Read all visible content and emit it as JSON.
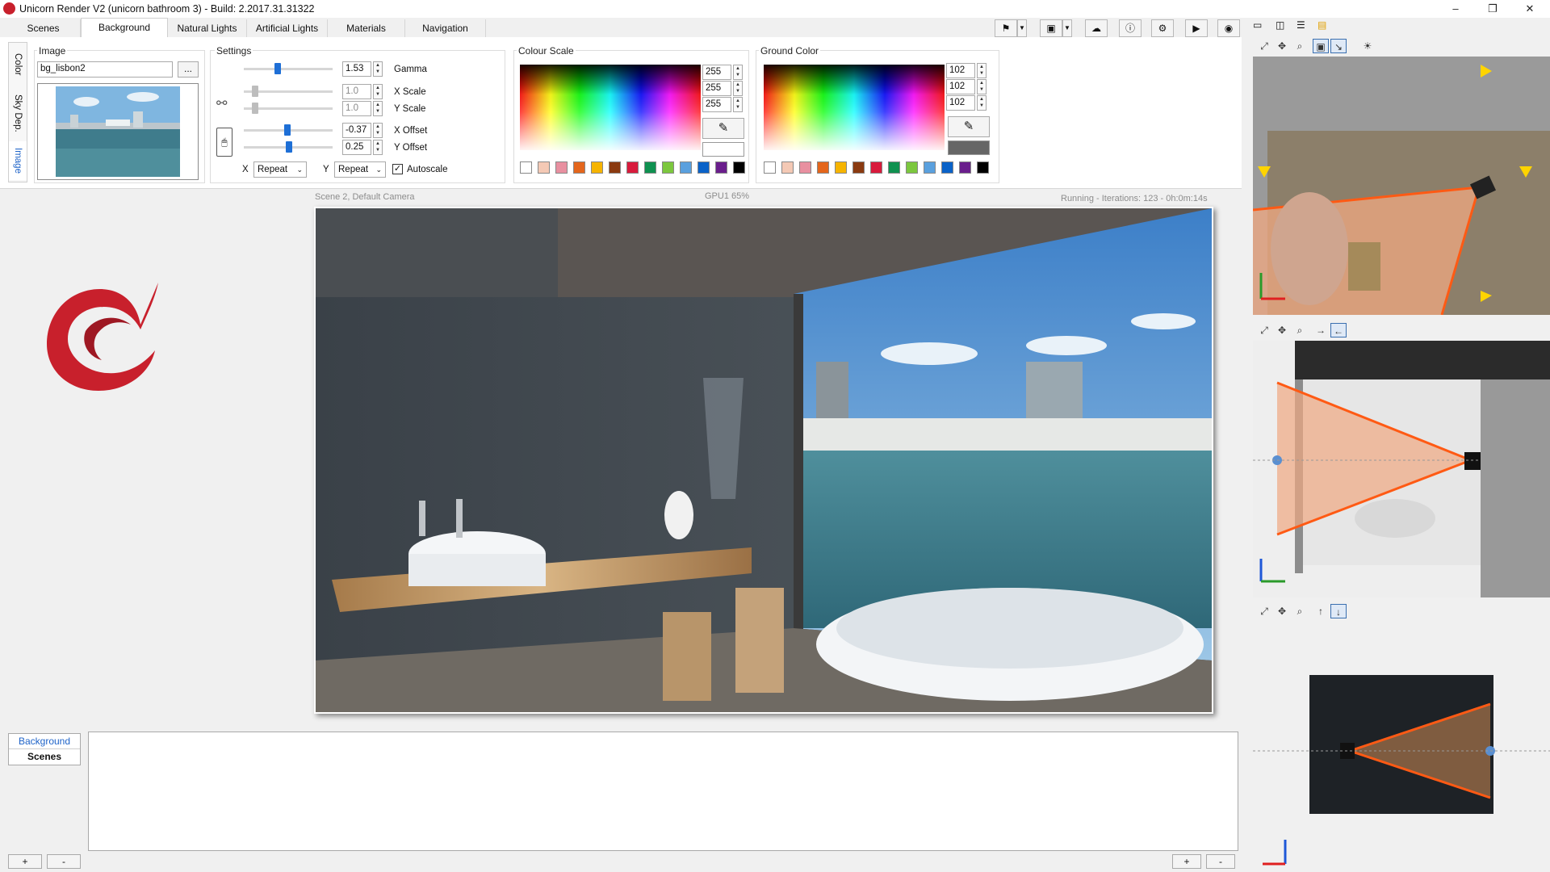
{
  "window": {
    "title": "Unicorn Render V2 (unicorn bathroom 3) - Build: 2.2017.31.31322",
    "minimize": "–",
    "restore": "❐",
    "close": "✕"
  },
  "tabs": [
    "Scenes",
    "Background",
    "Natural Lights",
    "Artificial Lights",
    "Materials",
    "Navigation"
  ],
  "active_tab": "Background",
  "toolbar": {
    "icons": [
      "flag-icon",
      "save-icon",
      "cloud-icon",
      "info-icon",
      "settings-icon",
      "render-icon",
      "camera-icon"
    ]
  },
  "side_tabs": [
    "Color",
    "Sky Dep.",
    "Image"
  ],
  "image_group": {
    "label": "Image",
    "filename": "bg_lisbon2",
    "browse": "..."
  },
  "settings": {
    "label": "Settings",
    "gamma": {
      "label": "Gamma",
      "value": "1.53",
      "level": 0.38
    },
    "x_scale": {
      "label": "X Scale",
      "value": "1.0",
      "level": 0.12
    },
    "y_scale": {
      "label": "Y Scale",
      "value": "1.0",
      "level": 0.12
    },
    "x_offset": {
      "label": "X Offset",
      "value": "-0.37",
      "level": 0.5
    },
    "y_offset": {
      "label": "Y Offset",
      "value": "0.25",
      "level": 0.52
    },
    "x_repeat_label": "X",
    "x_repeat": "Repeat",
    "y_repeat_label": "Y",
    "y_repeat": "Repeat",
    "autoscale_label": "Autoscale",
    "autoscale": true
  },
  "colour_scale": {
    "label": "Colour Scale",
    "r": "255",
    "g": "255",
    "b": "255",
    "preview": "#ffffff"
  },
  "ground_color": {
    "label": "Ground Color",
    "r": "102",
    "g": "102",
    "b": "102",
    "preview": "#666666"
  },
  "swatches": [
    "#ffffff",
    "#f4c9b5",
    "#e890a0",
    "#e4661c",
    "#f6b400",
    "#8a3a10",
    "#d81b3c",
    "#0f9150",
    "#7cc73e",
    "#5aa0de",
    "#0a62c8",
    "#6a1e8c",
    "#000000"
  ],
  "render": {
    "camera": "Scene 2, Default Camera",
    "gpu": "GPU1 65%",
    "status": "Running - Iterations: 123 - 0h:0m:14s"
  },
  "bottom_tabs": [
    "Background",
    "Scenes"
  ],
  "bottom_buttons": {
    "add": "+",
    "remove": "-"
  },
  "viewports": [
    {
      "tools": [
        "zoom-extents-icon",
        "pan-icon",
        "zoom-icon",
        "view-box-icon",
        "pick-icon",
        "sun-icon"
      ]
    },
    {
      "tools": [
        "zoom-extents-icon",
        "pan-icon",
        "zoom-icon",
        "arrow-right-icon",
        "arrow-left-icon"
      ]
    },
    {
      "tools": [
        "zoom-extents-icon",
        "pan-icon",
        "zoom-icon",
        "arrow-up-icon",
        "arrow-down-icon"
      ]
    }
  ]
}
